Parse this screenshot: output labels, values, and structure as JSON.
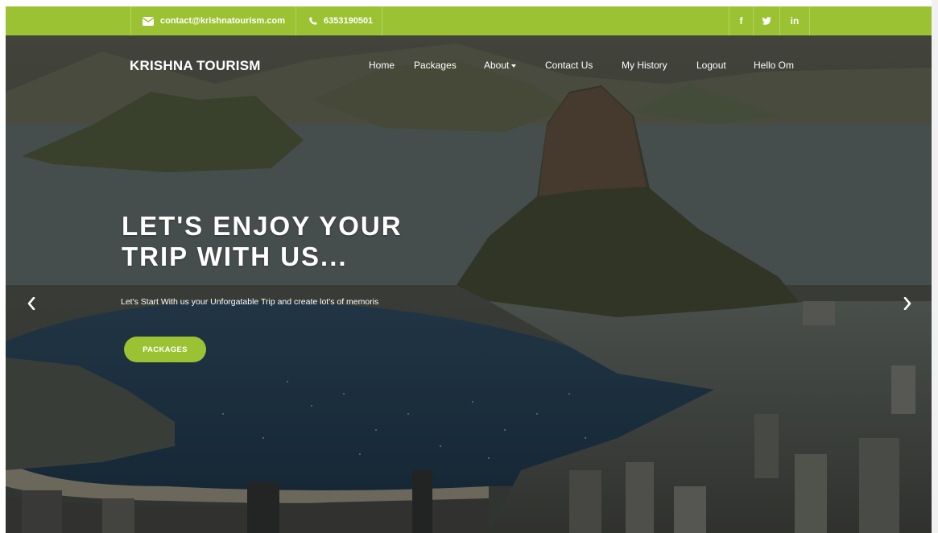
{
  "colors": {
    "accent": "#9ac232",
    "text": "#ffffff"
  },
  "topbar": {
    "email": "contact@krishnatourism.com",
    "email_icon": "envelope-icon",
    "phone": "6353190501",
    "phone_icon": "phone-icon",
    "social": [
      {
        "label": "f",
        "icon": "facebook-icon"
      },
      {
        "label": "t",
        "icon": "twitter-icon"
      },
      {
        "label": "in",
        "icon": "linkedin-icon"
      }
    ]
  },
  "navbar": {
    "brand": "KRISHNA TOURISM",
    "items": [
      "Home",
      "Packages",
      "About",
      "Contact Us",
      "My History",
      "Logout",
      "Hello Om"
    ]
  },
  "hero": {
    "headline_line1": "LET'S ENJOY YOUR",
    "headline_line2": "TRIP WITH US...",
    "subtext": "Let's Start With us your Unforgatable Trip and create lot's of memoris",
    "button_label": "PACKAGES",
    "prev_icon": "chevron-left-icon",
    "next_icon": "chevron-right-icon"
  }
}
